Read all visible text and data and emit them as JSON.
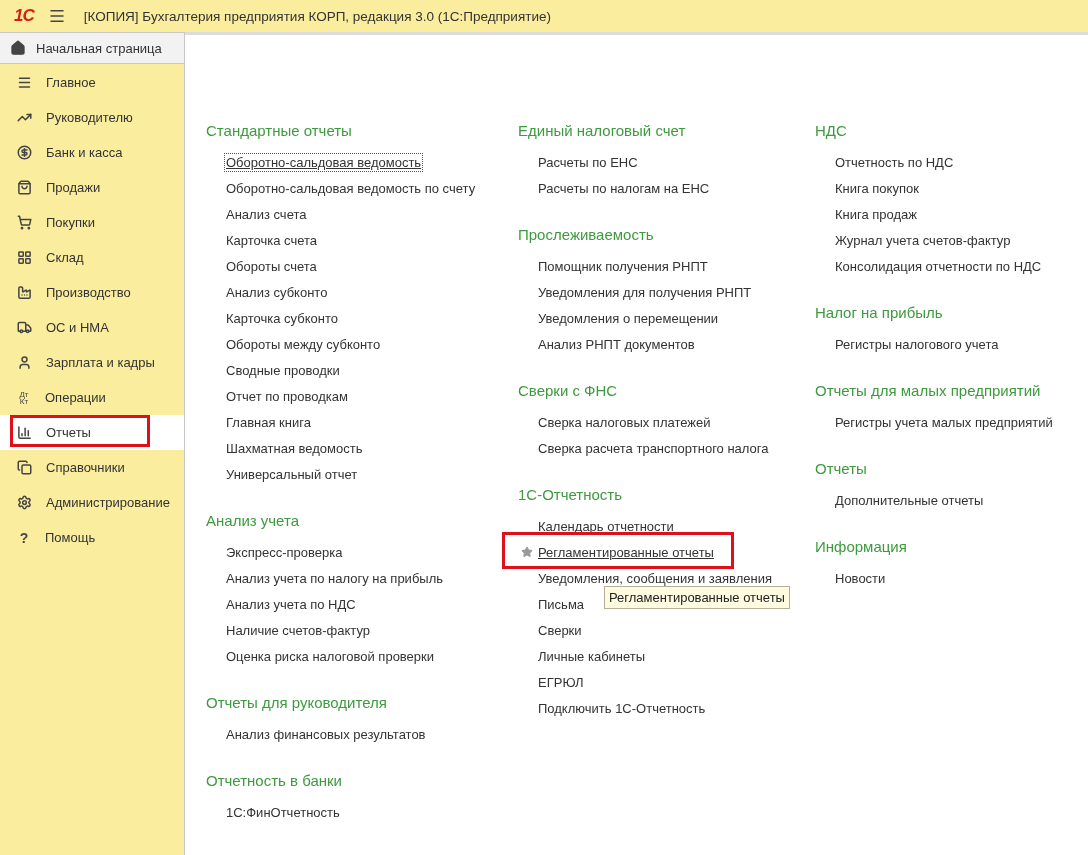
{
  "window": {
    "title": "[КОПИЯ] Бухгалтерия предприятия КОРП, редакция 3.0  (1С:Предприятие)",
    "logo": "1С"
  },
  "home": {
    "label": "Начальная страница"
  },
  "sidebar": {
    "items": [
      {
        "label": "Главное",
        "selected": false,
        "highlighted": false
      },
      {
        "label": "Руководителю",
        "selected": false,
        "highlighted": false
      },
      {
        "label": "Банк и касса",
        "selected": false,
        "highlighted": false
      },
      {
        "label": "Продажи",
        "selected": false,
        "highlighted": false
      },
      {
        "label": "Покупки",
        "selected": false,
        "highlighted": false
      },
      {
        "label": "Склад",
        "selected": false,
        "highlighted": false
      },
      {
        "label": "Производство",
        "selected": false,
        "highlighted": false
      },
      {
        "label": "ОС и НМА",
        "selected": false,
        "highlighted": false
      },
      {
        "label": "Зарплата и кадры",
        "selected": false,
        "highlighted": false
      },
      {
        "label": "Операции",
        "selected": false,
        "highlighted": false,
        "icon_label": [
          "Дт",
          "Кт"
        ]
      },
      {
        "label": "Отчеты",
        "selected": true,
        "highlighted": true
      },
      {
        "label": "Справочники",
        "selected": false,
        "highlighted": false
      },
      {
        "label": "Администрирование",
        "selected": false,
        "highlighted": false
      },
      {
        "label": "Помощь",
        "selected": false,
        "highlighted": false,
        "icon_label": [
          "?"
        ]
      }
    ]
  },
  "columns": [
    {
      "sections": [
        {
          "title": "Стандартные отчеты",
          "items": [
            {
              "label": "Оборотно-сальдовая ведомость",
              "focused": true
            },
            {
              "label": "Оборотно-сальдовая ведомость по счету"
            },
            {
              "label": "Анализ счета"
            },
            {
              "label": "Карточка счета"
            },
            {
              "label": "Обороты счета"
            },
            {
              "label": "Анализ субконто"
            },
            {
              "label": "Карточка субконто"
            },
            {
              "label": "Обороты между субконто"
            },
            {
              "label": "Сводные проводки"
            },
            {
              "label": "Отчет по проводкам"
            },
            {
              "label": "Главная книга"
            },
            {
              "label": "Шахматная ведомость"
            },
            {
              "label": "Универсальный отчет"
            }
          ]
        },
        {
          "title": "Анализ учета",
          "items": [
            {
              "label": "Экспресс-проверка"
            },
            {
              "label": "Анализ учета по налогу на прибыль"
            },
            {
              "label": "Анализ учета по НДС"
            },
            {
              "label": "Наличие счетов-фактур"
            },
            {
              "label": "Оценка риска налоговой проверки"
            }
          ]
        },
        {
          "title": "Отчеты для руководителя",
          "items": [
            {
              "label": "Анализ финансовых результатов"
            }
          ]
        },
        {
          "title": "Отчетность в банки",
          "items": [
            {
              "label": "1С:ФинОтчетность"
            }
          ]
        }
      ]
    },
    {
      "sections": [
        {
          "title": "Единый налоговый счет",
          "items": [
            {
              "label": "Расчеты по ЕНС"
            },
            {
              "label": "Расчеты по налогам на ЕНС"
            }
          ]
        },
        {
          "title": "Прослеживаемость",
          "items": [
            {
              "label": "Помощник получения РНПТ"
            },
            {
              "label": "Уведомления для получения РНПТ"
            },
            {
              "label": "Уведомления о перемещении"
            },
            {
              "label": "Анализ РНПТ документов"
            }
          ]
        },
        {
          "title": "Сверки с ФНС",
          "items": [
            {
              "label": "Сверка налоговых платежей"
            },
            {
              "label": "Сверка расчета транспортного налога"
            }
          ]
        },
        {
          "title": "1С-Отчетность",
          "items": [
            {
              "label": "Календарь отчетности"
            },
            {
              "label": "Регламентированные отчеты",
              "starred": true,
              "hovered": true,
              "highlighted": true,
              "tooltip": "Регламентированные отчеты"
            },
            {
              "label": "Уведомления, сообщения и заявления"
            },
            {
              "label": "Письма"
            },
            {
              "label": "Сверки"
            },
            {
              "label": "Личные кабинеты"
            },
            {
              "label": "ЕГРЮЛ"
            },
            {
              "label": "Подключить 1С-Отчетность"
            }
          ]
        }
      ]
    },
    {
      "sections": [
        {
          "title": "НДС",
          "items": [
            {
              "label": "Отчетность по НДС"
            },
            {
              "label": "Книга покупок"
            },
            {
              "label": "Книга продаж"
            },
            {
              "label": "Журнал учета счетов-фактур"
            },
            {
              "label": "Консолидация отчетности по НДС"
            }
          ]
        },
        {
          "title": "Налог на прибыль",
          "items": [
            {
              "label": "Регистры налогового учета"
            }
          ]
        },
        {
          "title": "Отчеты для малых предприятий",
          "items": [
            {
              "label": "Регистры учета малых предприятий"
            }
          ]
        },
        {
          "title": "Отчеты",
          "items": [
            {
              "label": "Дополнительные отчеты"
            }
          ]
        },
        {
          "title": "Информация",
          "items": [
            {
              "label": "Новости"
            }
          ]
        }
      ]
    }
  ]
}
